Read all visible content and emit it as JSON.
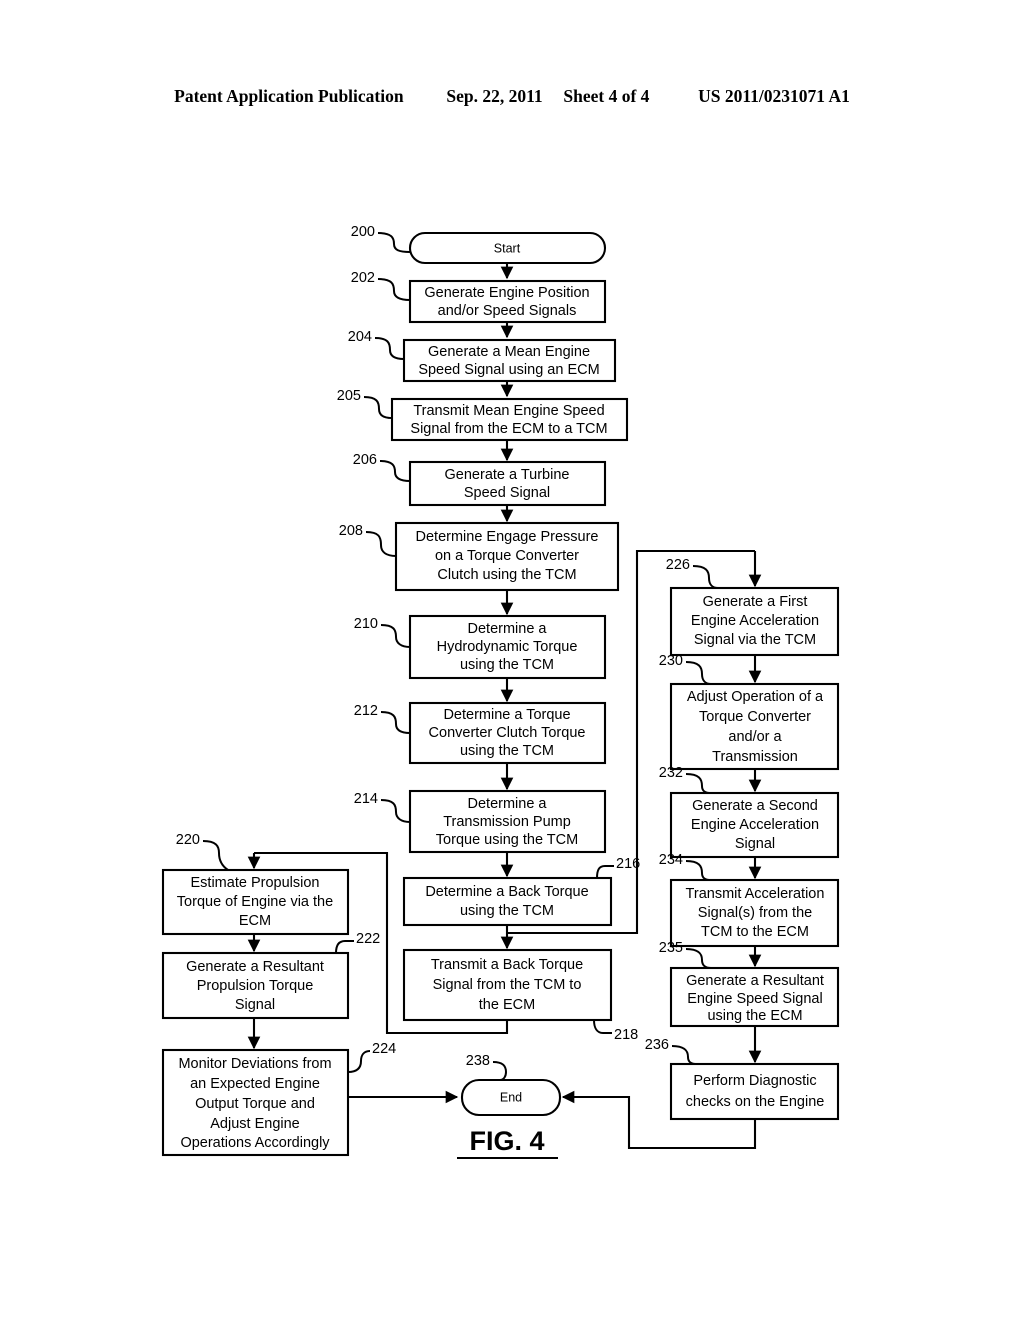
{
  "header": {
    "publication": "Patent Application Publication",
    "date": "Sep. 22, 2011",
    "sheet": "Sheet 4 of 4",
    "patent_number": "US 2011/0231071 A1"
  },
  "figure": {
    "label": "FIG. 4",
    "title": "FIG. 4"
  },
  "flowchart": {
    "nodes": [
      {
        "ref": "200",
        "shape": "terminal",
        "label": "Start"
      },
      {
        "ref": "202",
        "shape": "process",
        "label": "Generate Engine Position and/or Speed Signals",
        "lines": [
          "Generate Engine Position",
          "and/or Speed Signals"
        ]
      },
      {
        "ref": "204",
        "shape": "process",
        "label": "Generate a Mean Engine Speed Signal using an ECM",
        "lines": [
          "Generate a Mean Engine",
          "Speed Signal using an ECM"
        ]
      },
      {
        "ref": "205",
        "shape": "process",
        "label": "Transmit Mean Engine Speed Signal from the ECM to a TCM",
        "lines": [
          "Transmit Mean Engine Speed",
          "Signal from the ECM to a TCM"
        ]
      },
      {
        "ref": "206",
        "shape": "process",
        "label": "Generate a Turbine Speed Signal",
        "lines": [
          "Generate a Turbine",
          "Speed Signal"
        ]
      },
      {
        "ref": "208",
        "shape": "process",
        "label": "Determine Engage Pressure on a Torque Converter Clutch using the TCM",
        "lines": [
          "Determine Engage Pressure",
          "on a Torque Converter",
          "Clutch using the TCM"
        ]
      },
      {
        "ref": "210",
        "shape": "process",
        "label": "Determine a Hydrodynamic Torque using the TCM",
        "lines": [
          "Determine a",
          "Hydrodynamic Torque",
          "using the TCM"
        ]
      },
      {
        "ref": "212",
        "shape": "process",
        "label": "Determine a Torque Converter Clutch Torque using the TCM",
        "lines": [
          "Determine a Torque",
          "Converter Clutch Torque",
          "using the TCM"
        ]
      },
      {
        "ref": "214",
        "shape": "process",
        "label": "Determine a Transmission Pump Torque using the TCM",
        "lines": [
          "Determine a",
          "Transmission Pump",
          "Torque using the TCM"
        ]
      },
      {
        "ref": "216",
        "shape": "process",
        "label": "Determine a Back Torque using the TCM",
        "lines": [
          "Determine a Back Torque",
          "using the TCM"
        ]
      },
      {
        "ref": "218",
        "shape": "process",
        "label": "Transmit a Back Torque Signal from the TCM to the ECM",
        "lines": [
          "Transmit a Back Torque",
          "Signal from the TCM to",
          "the ECM"
        ]
      },
      {
        "ref": "220",
        "shape": "process",
        "label": "Estimate Propulsion Torque of Engine via the ECM",
        "lines": [
          "Estimate Propulsion",
          "Torque of Engine via the",
          "ECM"
        ]
      },
      {
        "ref": "222",
        "shape": "process",
        "label": "Generate a Resultant Propulsion Torque Signal",
        "lines": [
          "Generate a Resultant",
          "Propulsion Torque",
          "Signal"
        ]
      },
      {
        "ref": "224",
        "shape": "process",
        "label": "Monitor Deviations from an Expected Engine Output Torque and Adjust Engine Operations Accordingly",
        "lines": [
          "Monitor Deviations from",
          "an Expected Engine",
          "Output Torque and",
          "Adjust Engine",
          "Operations Accordingly"
        ]
      },
      {
        "ref": "226",
        "shape": "process",
        "label": "Generate a First Engine Acceleration Signal via the TCM",
        "lines": [
          "Generate a First",
          "Engine Acceleration",
          "Signal via the TCM"
        ]
      },
      {
        "ref": "230",
        "shape": "process",
        "label": "Adjust Operation of a Torque Converter and/or a Transmission",
        "lines": [
          "Adjust Operation of a",
          "Torque Converter",
          "and/or a",
          "Transmission"
        ]
      },
      {
        "ref": "232",
        "shape": "process",
        "label": "Generate a Second Engine Acceleration Signal",
        "lines": [
          "Generate a Second",
          "Engine Acceleration",
          "Signal"
        ]
      },
      {
        "ref": "234",
        "shape": "process",
        "label": "Transmit Acceleration Signal(s) from the TCM to the ECM",
        "lines": [
          "Transmit Acceleration",
          "Signal(s) from the",
          "TCM to the ECM"
        ]
      },
      {
        "ref": "235",
        "shape": "process",
        "label": "Generate a Resultant Engine Speed Signal using the ECM",
        "lines": [
          "Generate a Resultant",
          "Engine Speed Signal",
          "using the ECM"
        ]
      },
      {
        "ref": "236",
        "shape": "process",
        "label": "Perform Diagnostic checks on the Engine",
        "lines": [
          "Perform Diagnostic",
          "checks on the Engine"
        ]
      },
      {
        "ref": "238",
        "shape": "terminal",
        "label": "End"
      }
    ],
    "text": {
      "n200_l1": "Start",
      "n202_l1": "Generate Engine Position",
      "n202_l2": "and/or Speed Signals",
      "n204_l1": "Generate a Mean Engine",
      "n204_l2": "Speed Signal using an ECM",
      "n205_l1": "Transmit Mean Engine Speed",
      "n205_l2": "Signal from the ECM to a TCM",
      "n206_l1": "Generate a Turbine",
      "n206_l2": "Speed Signal",
      "n208_l1": "Determine Engage Pressure",
      "n208_l2": "on a Torque Converter",
      "n208_l3": "Clutch using the TCM",
      "n210_l1": "Determine a",
      "n210_l2": "Hydrodynamic Torque",
      "n210_l3": "using the TCM",
      "n212_l1": "Determine a Torque",
      "n212_l2": "Converter Clutch Torque",
      "n212_l3": "using the TCM",
      "n214_l1": "Determine a",
      "n214_l2": "Transmission Pump",
      "n214_l3": "Torque using the TCM",
      "n216_l1": "Determine a Back Torque",
      "n216_l2": "using the TCM",
      "n218_l1": "Transmit a Back Torque",
      "n218_l2": "Signal from the TCM to",
      "n218_l3": "the ECM",
      "n220_l1": "Estimate Propulsion",
      "n220_l2": "Torque of Engine via the",
      "n220_l3": "ECM",
      "n222_l1": "Generate a Resultant",
      "n222_l2": "Propulsion Torque",
      "n222_l3": "Signal",
      "n224_l1": "Monitor Deviations from",
      "n224_l2": "an Expected Engine",
      "n224_l3": "Output Torque and",
      "n224_l4": "Adjust Engine",
      "n224_l5": "Operations Accordingly",
      "n226_l1": "Generate a First",
      "n226_l2": "Engine Acceleration",
      "n226_l3": "Signal via the TCM",
      "n230_l1": "Adjust Operation of a",
      "n230_l2": "Torque Converter",
      "n230_l3": "and/or a",
      "n230_l4": "Transmission",
      "n232_l1": "Generate a Second",
      "n232_l2": "Engine Acceleration",
      "n232_l3": "Signal",
      "n234_l1": "Transmit Acceleration",
      "n234_l2": "Signal(s) from the",
      "n234_l3": "TCM to the ECM",
      "n235_l1": "Generate a Resultant",
      "n235_l2": "Engine Speed Signal",
      "n235_l3": "using the ECM",
      "n236_l1": "Perform Diagnostic",
      "n236_l2": "checks on the Engine",
      "n238_l1": "End"
    },
    "refs": {
      "r200": "200",
      "r202": "202",
      "r204": "204",
      "r205": "205",
      "r206": "206",
      "r208": "208",
      "r210": "210",
      "r212": "212",
      "r214": "214",
      "r216": "216",
      "r218": "218",
      "r220": "220",
      "r222": "222",
      "r224": "224",
      "r226": "226",
      "r230": "230",
      "r232": "232",
      "r234": "234",
      "r235": "235",
      "r236": "236",
      "r238": "238"
    }
  },
  "colors": {
    "ink": "#000000",
    "paper": "#ffffff"
  }
}
